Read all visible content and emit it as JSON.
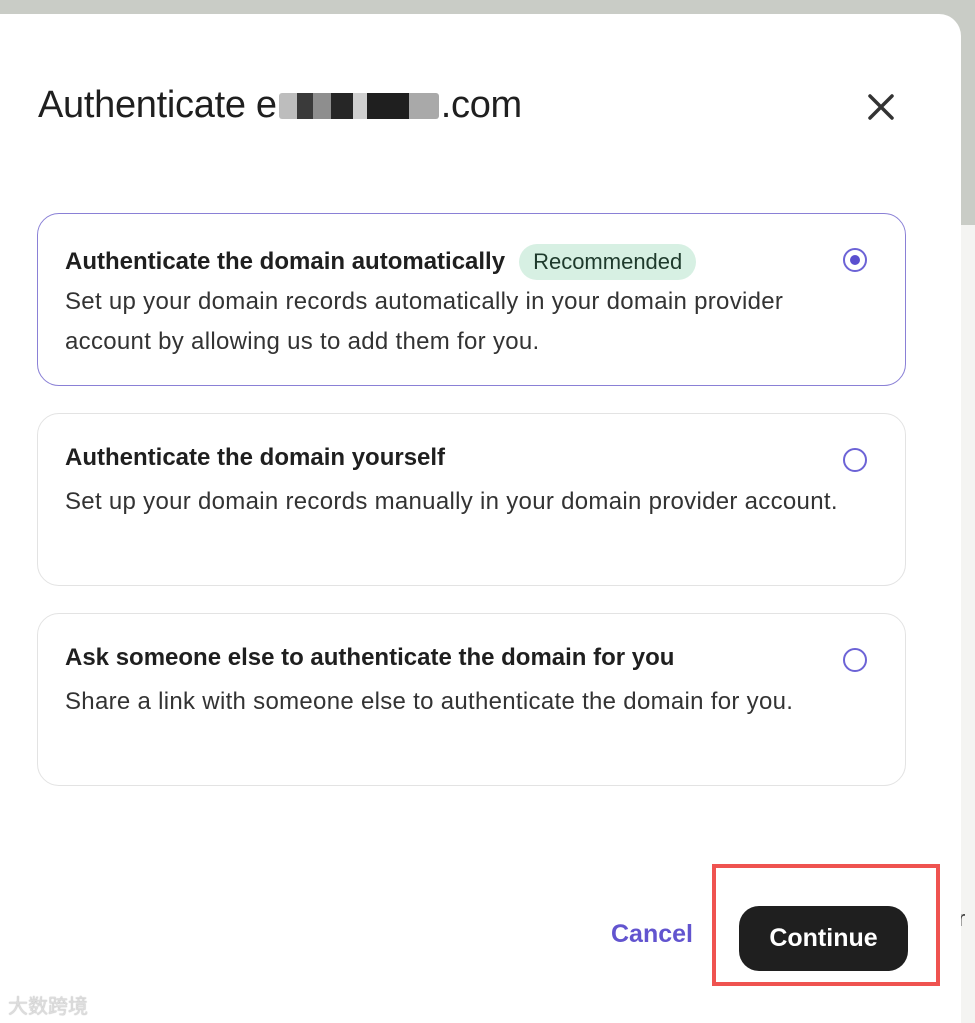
{
  "dialog": {
    "title_prefix": "Authenticate e",
    "title_suffix": ".com",
    "close_icon": "close-icon"
  },
  "options": [
    {
      "title": "Authenticate the domain automatically",
      "badge": "Recommended",
      "description": "Set up your domain records automatically in your domain provider account by allowing us to add them for you.",
      "selected": true
    },
    {
      "title": "Authenticate the domain yourself",
      "description": "Set up your domain records manually in your domain provider account.",
      "selected": false
    },
    {
      "title": "Ask someone else to authenticate the domain for you",
      "description": "Share a link with someone else to authenticate the domain for you.",
      "selected": false
    }
  ],
  "footer": {
    "cancel_label": "Cancel",
    "continue_label": "Continue"
  },
  "background": {
    "edge_text": "r"
  },
  "watermark": "大数跨境",
  "colors": {
    "accent": "#6254cf",
    "primary_button": "#1f1f1f",
    "badge_bg": "#d7f0e3",
    "highlight_box": "#ef5350"
  }
}
